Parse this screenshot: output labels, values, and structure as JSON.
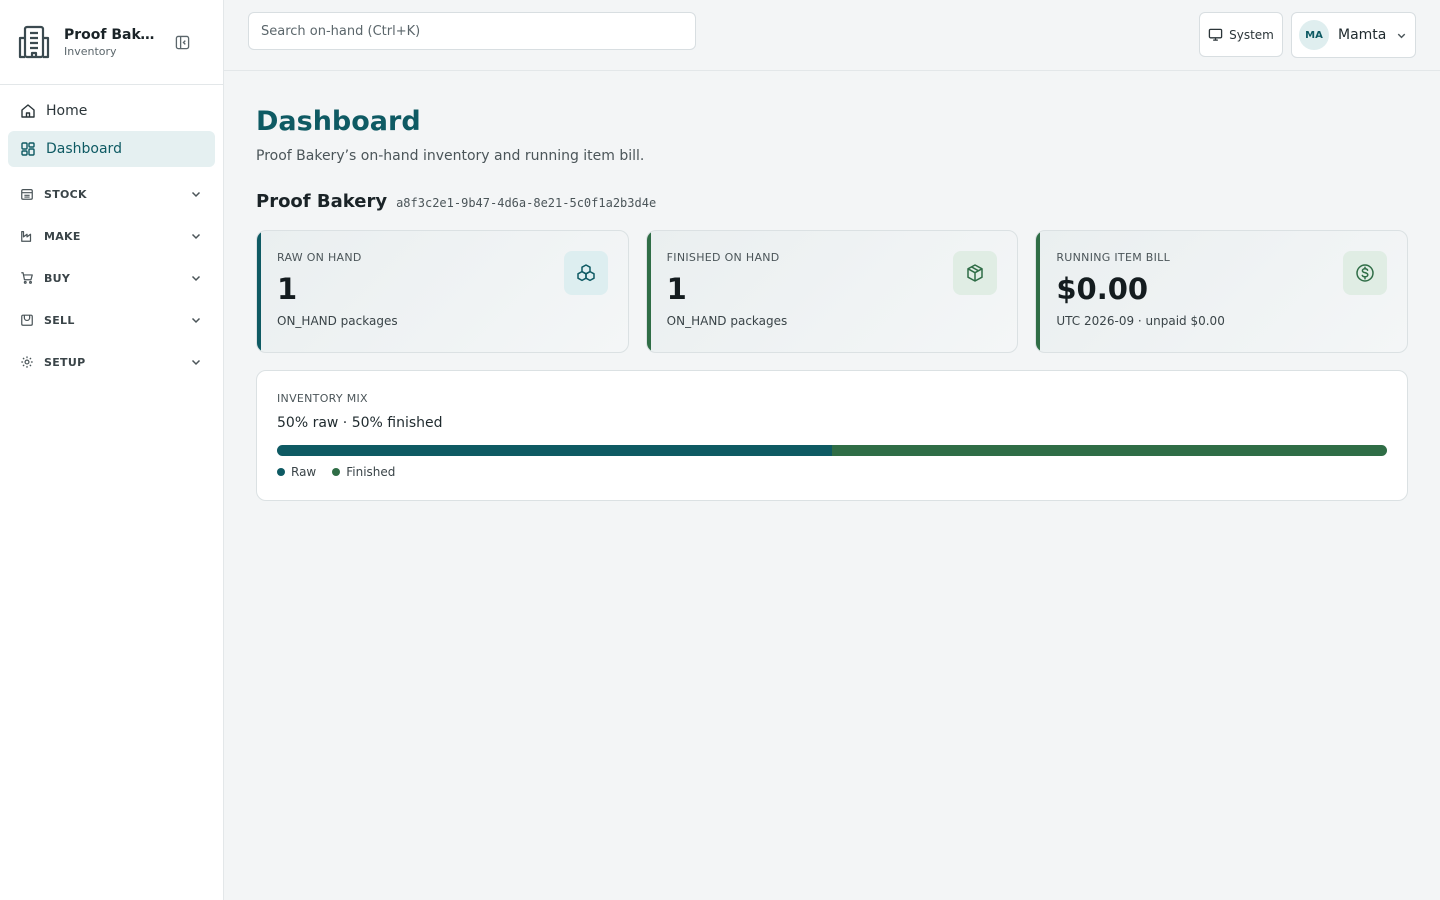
{
  "brand": {
    "name": "Proof Bakery",
    "subtitle": "Inventory"
  },
  "nav": {
    "items": [
      {
        "label": "Home",
        "icon": "home-icon",
        "active": false
      },
      {
        "label": "Dashboard",
        "icon": "dashboard-icon",
        "active": true
      }
    ],
    "sections": [
      {
        "label": "STOCK",
        "icon": "stock-icon"
      },
      {
        "label": "MAKE",
        "icon": "make-icon"
      },
      {
        "label": "BUY",
        "icon": "cart-icon"
      },
      {
        "label": "SELL",
        "icon": "sell-icon"
      },
      {
        "label": "SETUP",
        "icon": "gear-icon"
      }
    ]
  },
  "topbar": {
    "search_placeholder": "Search on-hand (Ctrl+K)",
    "theme_label": "System",
    "user": {
      "initials": "MA",
      "name": "Mamta"
    }
  },
  "page": {
    "title": "Dashboard",
    "subtitle": "Proof Bakery’s on-hand inventory and running item bill.",
    "org_name": "Proof Bakery",
    "org_id": "a8f3c2e1-9b47-4d6a-8e21-5c0f1a2b3d4e"
  },
  "cards": [
    {
      "label": "RAW ON HAND",
      "value": "1",
      "note": "ON_HAND packages",
      "icon": "boxes-icon",
      "accent": "#0e5a63"
    },
    {
      "label": "FINISHED ON HAND",
      "value": "1",
      "note": "ON_HAND packages",
      "icon": "package-icon",
      "accent": "#2f6d46"
    },
    {
      "label": "RUNNING ITEM BILL",
      "value": "$0.00",
      "note": "UTC 2026-09 · unpaid $0.00",
      "icon": "dollar-circle-icon",
      "accent": "#2f6d46"
    }
  ],
  "mix": {
    "label": "INVENTORY MIX",
    "summary": "50% raw · 50% finished",
    "raw_fraction": 0.5,
    "finished_fraction": 0.5,
    "legend_raw": "Raw",
    "legend_finished": "Finished",
    "raw_color": "#0e5a63",
    "finished_color": "#2f6d46"
  }
}
